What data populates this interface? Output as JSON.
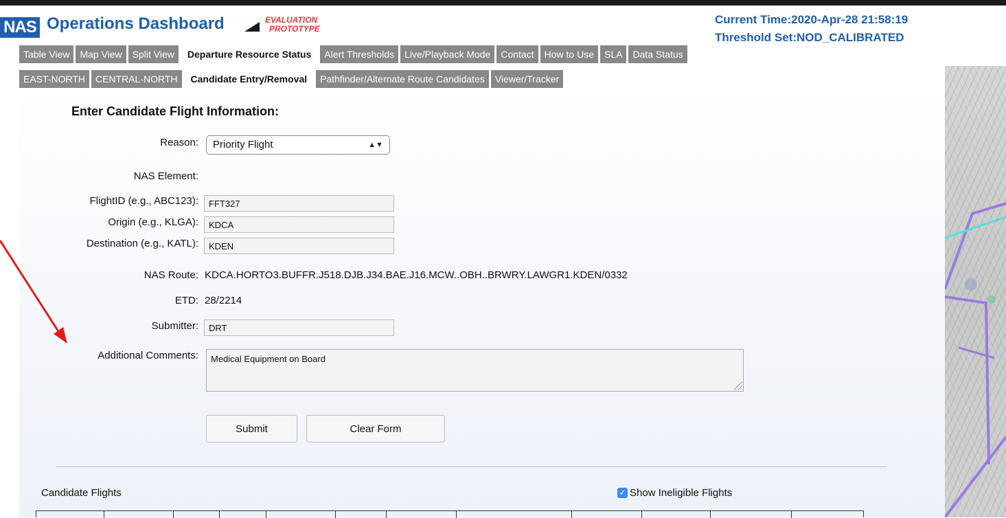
{
  "header": {
    "logo": "NAS",
    "title": "Operations Dashboard",
    "eval_line1": "EVALUATION",
    "eval_line2": "PROTOTYPE",
    "current_time": "Current  Time:2020-Apr-28 21:58:19",
    "threshold_set": "Threshold Set:NOD_CALIBRATED"
  },
  "tabs_main": [
    {
      "label": "Table View",
      "active": false
    },
    {
      "label": "Map View",
      "active": false
    },
    {
      "label": "Split View",
      "active": false
    },
    {
      "label": "Departure Resource Status",
      "active": true
    },
    {
      "label": "Alert Thresholds",
      "active": false
    },
    {
      "label": "Live/Playback Mode",
      "active": false
    },
    {
      "label": "Contact",
      "active": false
    },
    {
      "label": "How to Use",
      "active": false
    },
    {
      "label": "SLA",
      "active": false
    },
    {
      "label": "Data Status",
      "active": false
    }
  ],
  "tabs_sub": [
    {
      "label": "EAST-NORTH",
      "active": false
    },
    {
      "label": "CENTRAL-NORTH",
      "active": false
    },
    {
      "label": "Candidate Entry/Removal",
      "active": true
    },
    {
      "label": "Pathfinder/Alternate Route Candidates",
      "active": false
    },
    {
      "label": "Viewer/Tracker",
      "active": false
    }
  ],
  "form": {
    "heading": "Enter Candidate Flight Information:",
    "reason_label": "Reason:",
    "reason_value": "Priority Flight",
    "nas_element_label": "NAS Element:",
    "flightid_label": "FlightID (e.g., ABC123):",
    "flightid_value": "FFT327",
    "origin_label": "Origin (e.g., KLGA):",
    "origin_value": "KDCA",
    "destination_label": "Destination (e.g., KATL):",
    "destination_value": "KDEN",
    "nas_route_label": "NAS Route:",
    "nas_route_value": "KDCA.HORTO3.BUFFR.J518.DJB.J34.BAE.J16.MCW..OBH..BRWRY.LAWGR1.KDEN/0332",
    "etd_label": "ETD:",
    "etd_value": "28/2214",
    "submitter_label": "Submitter:",
    "submitter_value": "DRT",
    "comments_label": "Additional Comments:",
    "comments_value": "Medical Equipment on Board",
    "submit_label": "Submit",
    "clear_label": "Clear Form"
  },
  "candidates": {
    "title": "Candidate Flights",
    "show_ineligible_label": "Show Ineligible Flights",
    "show_ineligible_checked": true
  },
  "colors": {
    "brand": "#1f5fae",
    "tab_inactive": "#888888",
    "eval_red": "#e23b3b",
    "annotation_arrow": "#e01b1b",
    "route_purple": "#9a7be0",
    "route_cyan": "#4fe0e6"
  }
}
